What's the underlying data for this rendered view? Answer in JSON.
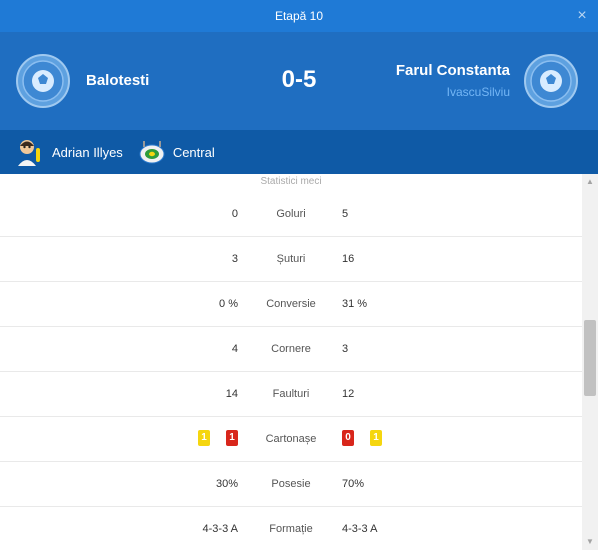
{
  "window": {
    "title": "Etapă 10",
    "close_icon": "×"
  },
  "match": {
    "home_team": "Balotesti",
    "away_team": "Farul Constanta",
    "away_manager": "IvascuSilviu",
    "score": "0-5"
  },
  "info": {
    "referee": "Adrian Illyes",
    "stadium": "Central"
  },
  "stats": {
    "section_title": "Statistici meci",
    "rows": [
      {
        "label": "Goluri",
        "home": "0",
        "away": "5"
      },
      {
        "label": "Șuturi",
        "home": "3",
        "away": "16"
      },
      {
        "label": "Conversie",
        "home": "0 %",
        "away": "31 %"
      },
      {
        "label": "Cornere",
        "home": "4",
        "away": "3"
      },
      {
        "label": "Faulturi",
        "home": "14",
        "away": "12"
      },
      {
        "label": "Cartonașe",
        "home_yellow": "1",
        "home_red": "1",
        "away_red": "0",
        "away_yellow": "1"
      },
      {
        "label": "Posesie",
        "home": "30%",
        "away": "70%"
      },
      {
        "label": "Formație",
        "home": "4-3-3 A",
        "away": "4-3-3 A"
      }
    ]
  },
  "colors": {
    "titlebar": "#1f7ad6",
    "header": "#1f6ec1",
    "info_bar": "#0f5aa6",
    "yellow_card": "#f5d60f",
    "red_card": "#d8261b"
  },
  "icons": {
    "home_badge": "football-badge-icon",
    "away_badge": "football-badge-icon",
    "referee": "referee-avatar-icon",
    "stadium": "stadium-icon"
  }
}
